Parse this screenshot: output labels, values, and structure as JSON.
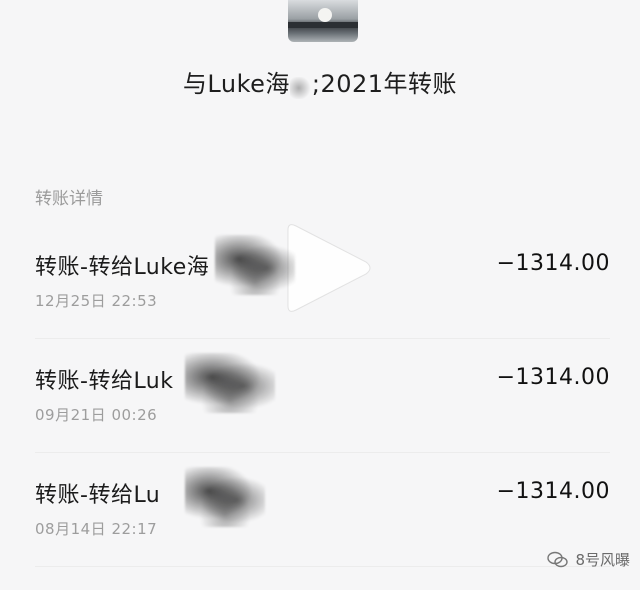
{
  "header": {
    "avatar_icon": "avatar-photo-lake",
    "title_prefix": "与Luke海",
    "title_suffix": ";2021年转账"
  },
  "section": {
    "label": "转账详情"
  },
  "transactions": [
    {
      "title": "转账-转给Luke海",
      "time": "12月25日 22:53",
      "amount": "−1314.00"
    },
    {
      "title": "转账-转给Luk",
      "time": "09月21日 00:26",
      "amount": "−1314.00"
    },
    {
      "title": "转账-转给Lu",
      "time": "08月14日 22:17",
      "amount": "−1314.00"
    }
  ],
  "watermark": {
    "icon": "wechat-icon",
    "text": "8号风曝"
  }
}
